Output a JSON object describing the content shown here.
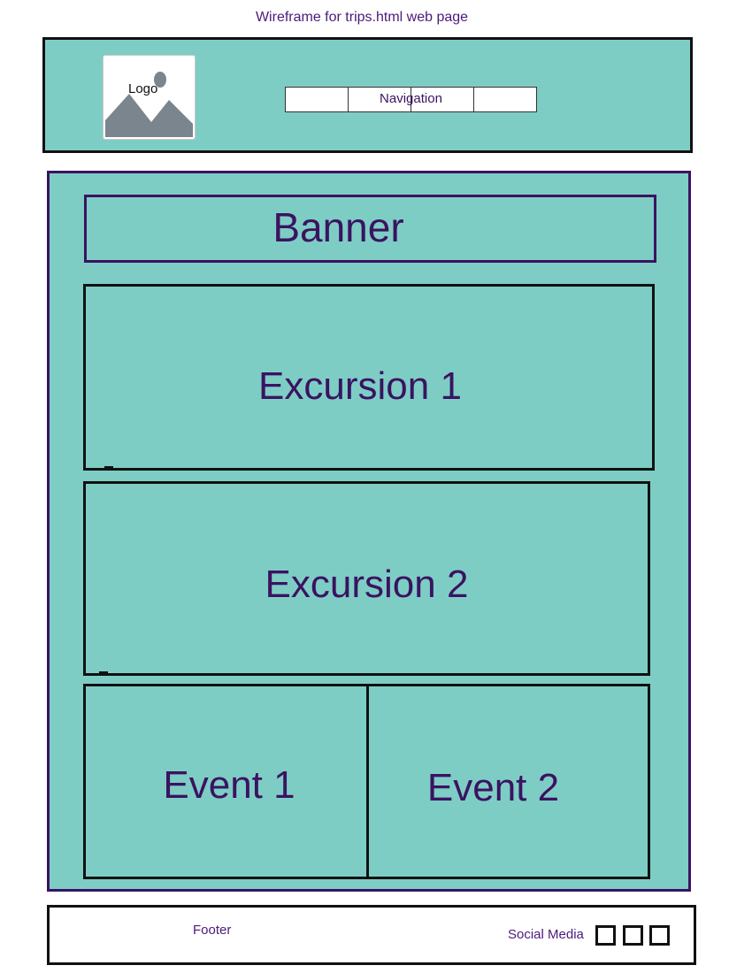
{
  "page_title": "Wireframe for trips.html web page",
  "header": {
    "logo_label": "Logo",
    "navigation_label": "Navigation"
  },
  "main": {
    "banner_label": "Banner",
    "excursions": [
      "Excursion 1",
      "Excursion 2"
    ],
    "events": [
      "Event 1",
      "Event 2"
    ]
  },
  "footer": {
    "footer_label": "Footer",
    "social_media_label": "Social Media"
  },
  "colors": {
    "section_fill": "#7ecdc5",
    "text_purple": "#3a1361",
    "border_dark": "#111111"
  },
  "icons": {
    "logo": "image-placeholder-icon"
  }
}
